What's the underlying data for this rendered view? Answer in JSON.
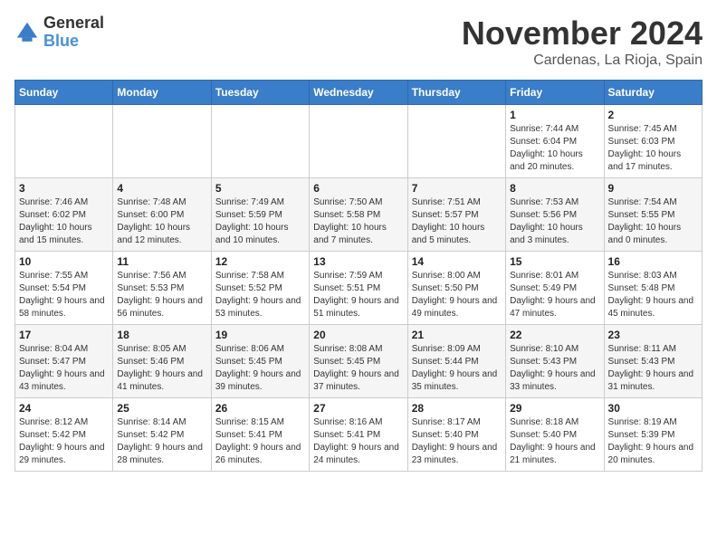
{
  "header": {
    "logo_line1": "General",
    "logo_line2": "Blue",
    "month": "November 2024",
    "location": "Cardenas, La Rioja, Spain"
  },
  "weekdays": [
    "Sunday",
    "Monday",
    "Tuesday",
    "Wednesday",
    "Thursday",
    "Friday",
    "Saturday"
  ],
  "weeks": [
    [
      {
        "day": "",
        "info": ""
      },
      {
        "day": "",
        "info": ""
      },
      {
        "day": "",
        "info": ""
      },
      {
        "day": "",
        "info": ""
      },
      {
        "day": "",
        "info": ""
      },
      {
        "day": "1",
        "info": "Sunrise: 7:44 AM\nSunset: 6:04 PM\nDaylight: 10 hours and 20 minutes."
      },
      {
        "day": "2",
        "info": "Sunrise: 7:45 AM\nSunset: 6:03 PM\nDaylight: 10 hours and 17 minutes."
      }
    ],
    [
      {
        "day": "3",
        "info": "Sunrise: 7:46 AM\nSunset: 6:02 PM\nDaylight: 10 hours and 15 minutes."
      },
      {
        "day": "4",
        "info": "Sunrise: 7:48 AM\nSunset: 6:00 PM\nDaylight: 10 hours and 12 minutes."
      },
      {
        "day": "5",
        "info": "Sunrise: 7:49 AM\nSunset: 5:59 PM\nDaylight: 10 hours and 10 minutes."
      },
      {
        "day": "6",
        "info": "Sunrise: 7:50 AM\nSunset: 5:58 PM\nDaylight: 10 hours and 7 minutes."
      },
      {
        "day": "7",
        "info": "Sunrise: 7:51 AM\nSunset: 5:57 PM\nDaylight: 10 hours and 5 minutes."
      },
      {
        "day": "8",
        "info": "Sunrise: 7:53 AM\nSunset: 5:56 PM\nDaylight: 10 hours and 3 minutes."
      },
      {
        "day": "9",
        "info": "Sunrise: 7:54 AM\nSunset: 5:55 PM\nDaylight: 10 hours and 0 minutes."
      }
    ],
    [
      {
        "day": "10",
        "info": "Sunrise: 7:55 AM\nSunset: 5:54 PM\nDaylight: 9 hours and 58 minutes."
      },
      {
        "day": "11",
        "info": "Sunrise: 7:56 AM\nSunset: 5:53 PM\nDaylight: 9 hours and 56 minutes."
      },
      {
        "day": "12",
        "info": "Sunrise: 7:58 AM\nSunset: 5:52 PM\nDaylight: 9 hours and 53 minutes."
      },
      {
        "day": "13",
        "info": "Sunrise: 7:59 AM\nSunset: 5:51 PM\nDaylight: 9 hours and 51 minutes."
      },
      {
        "day": "14",
        "info": "Sunrise: 8:00 AM\nSunset: 5:50 PM\nDaylight: 9 hours and 49 minutes."
      },
      {
        "day": "15",
        "info": "Sunrise: 8:01 AM\nSunset: 5:49 PM\nDaylight: 9 hours and 47 minutes."
      },
      {
        "day": "16",
        "info": "Sunrise: 8:03 AM\nSunset: 5:48 PM\nDaylight: 9 hours and 45 minutes."
      }
    ],
    [
      {
        "day": "17",
        "info": "Sunrise: 8:04 AM\nSunset: 5:47 PM\nDaylight: 9 hours and 43 minutes."
      },
      {
        "day": "18",
        "info": "Sunrise: 8:05 AM\nSunset: 5:46 PM\nDaylight: 9 hours and 41 minutes."
      },
      {
        "day": "19",
        "info": "Sunrise: 8:06 AM\nSunset: 5:45 PM\nDaylight: 9 hours and 39 minutes."
      },
      {
        "day": "20",
        "info": "Sunrise: 8:08 AM\nSunset: 5:45 PM\nDaylight: 9 hours and 37 minutes."
      },
      {
        "day": "21",
        "info": "Sunrise: 8:09 AM\nSunset: 5:44 PM\nDaylight: 9 hours and 35 minutes."
      },
      {
        "day": "22",
        "info": "Sunrise: 8:10 AM\nSunset: 5:43 PM\nDaylight: 9 hours and 33 minutes."
      },
      {
        "day": "23",
        "info": "Sunrise: 8:11 AM\nSunset: 5:43 PM\nDaylight: 9 hours and 31 minutes."
      }
    ],
    [
      {
        "day": "24",
        "info": "Sunrise: 8:12 AM\nSunset: 5:42 PM\nDaylight: 9 hours and 29 minutes."
      },
      {
        "day": "25",
        "info": "Sunrise: 8:14 AM\nSunset: 5:42 PM\nDaylight: 9 hours and 28 minutes."
      },
      {
        "day": "26",
        "info": "Sunrise: 8:15 AM\nSunset: 5:41 PM\nDaylight: 9 hours and 26 minutes."
      },
      {
        "day": "27",
        "info": "Sunrise: 8:16 AM\nSunset: 5:41 PM\nDaylight: 9 hours and 24 minutes."
      },
      {
        "day": "28",
        "info": "Sunrise: 8:17 AM\nSunset: 5:40 PM\nDaylight: 9 hours and 23 minutes."
      },
      {
        "day": "29",
        "info": "Sunrise: 8:18 AM\nSunset: 5:40 PM\nDaylight: 9 hours and 21 minutes."
      },
      {
        "day": "30",
        "info": "Sunrise: 8:19 AM\nSunset: 5:39 PM\nDaylight: 9 hours and 20 minutes."
      }
    ]
  ]
}
